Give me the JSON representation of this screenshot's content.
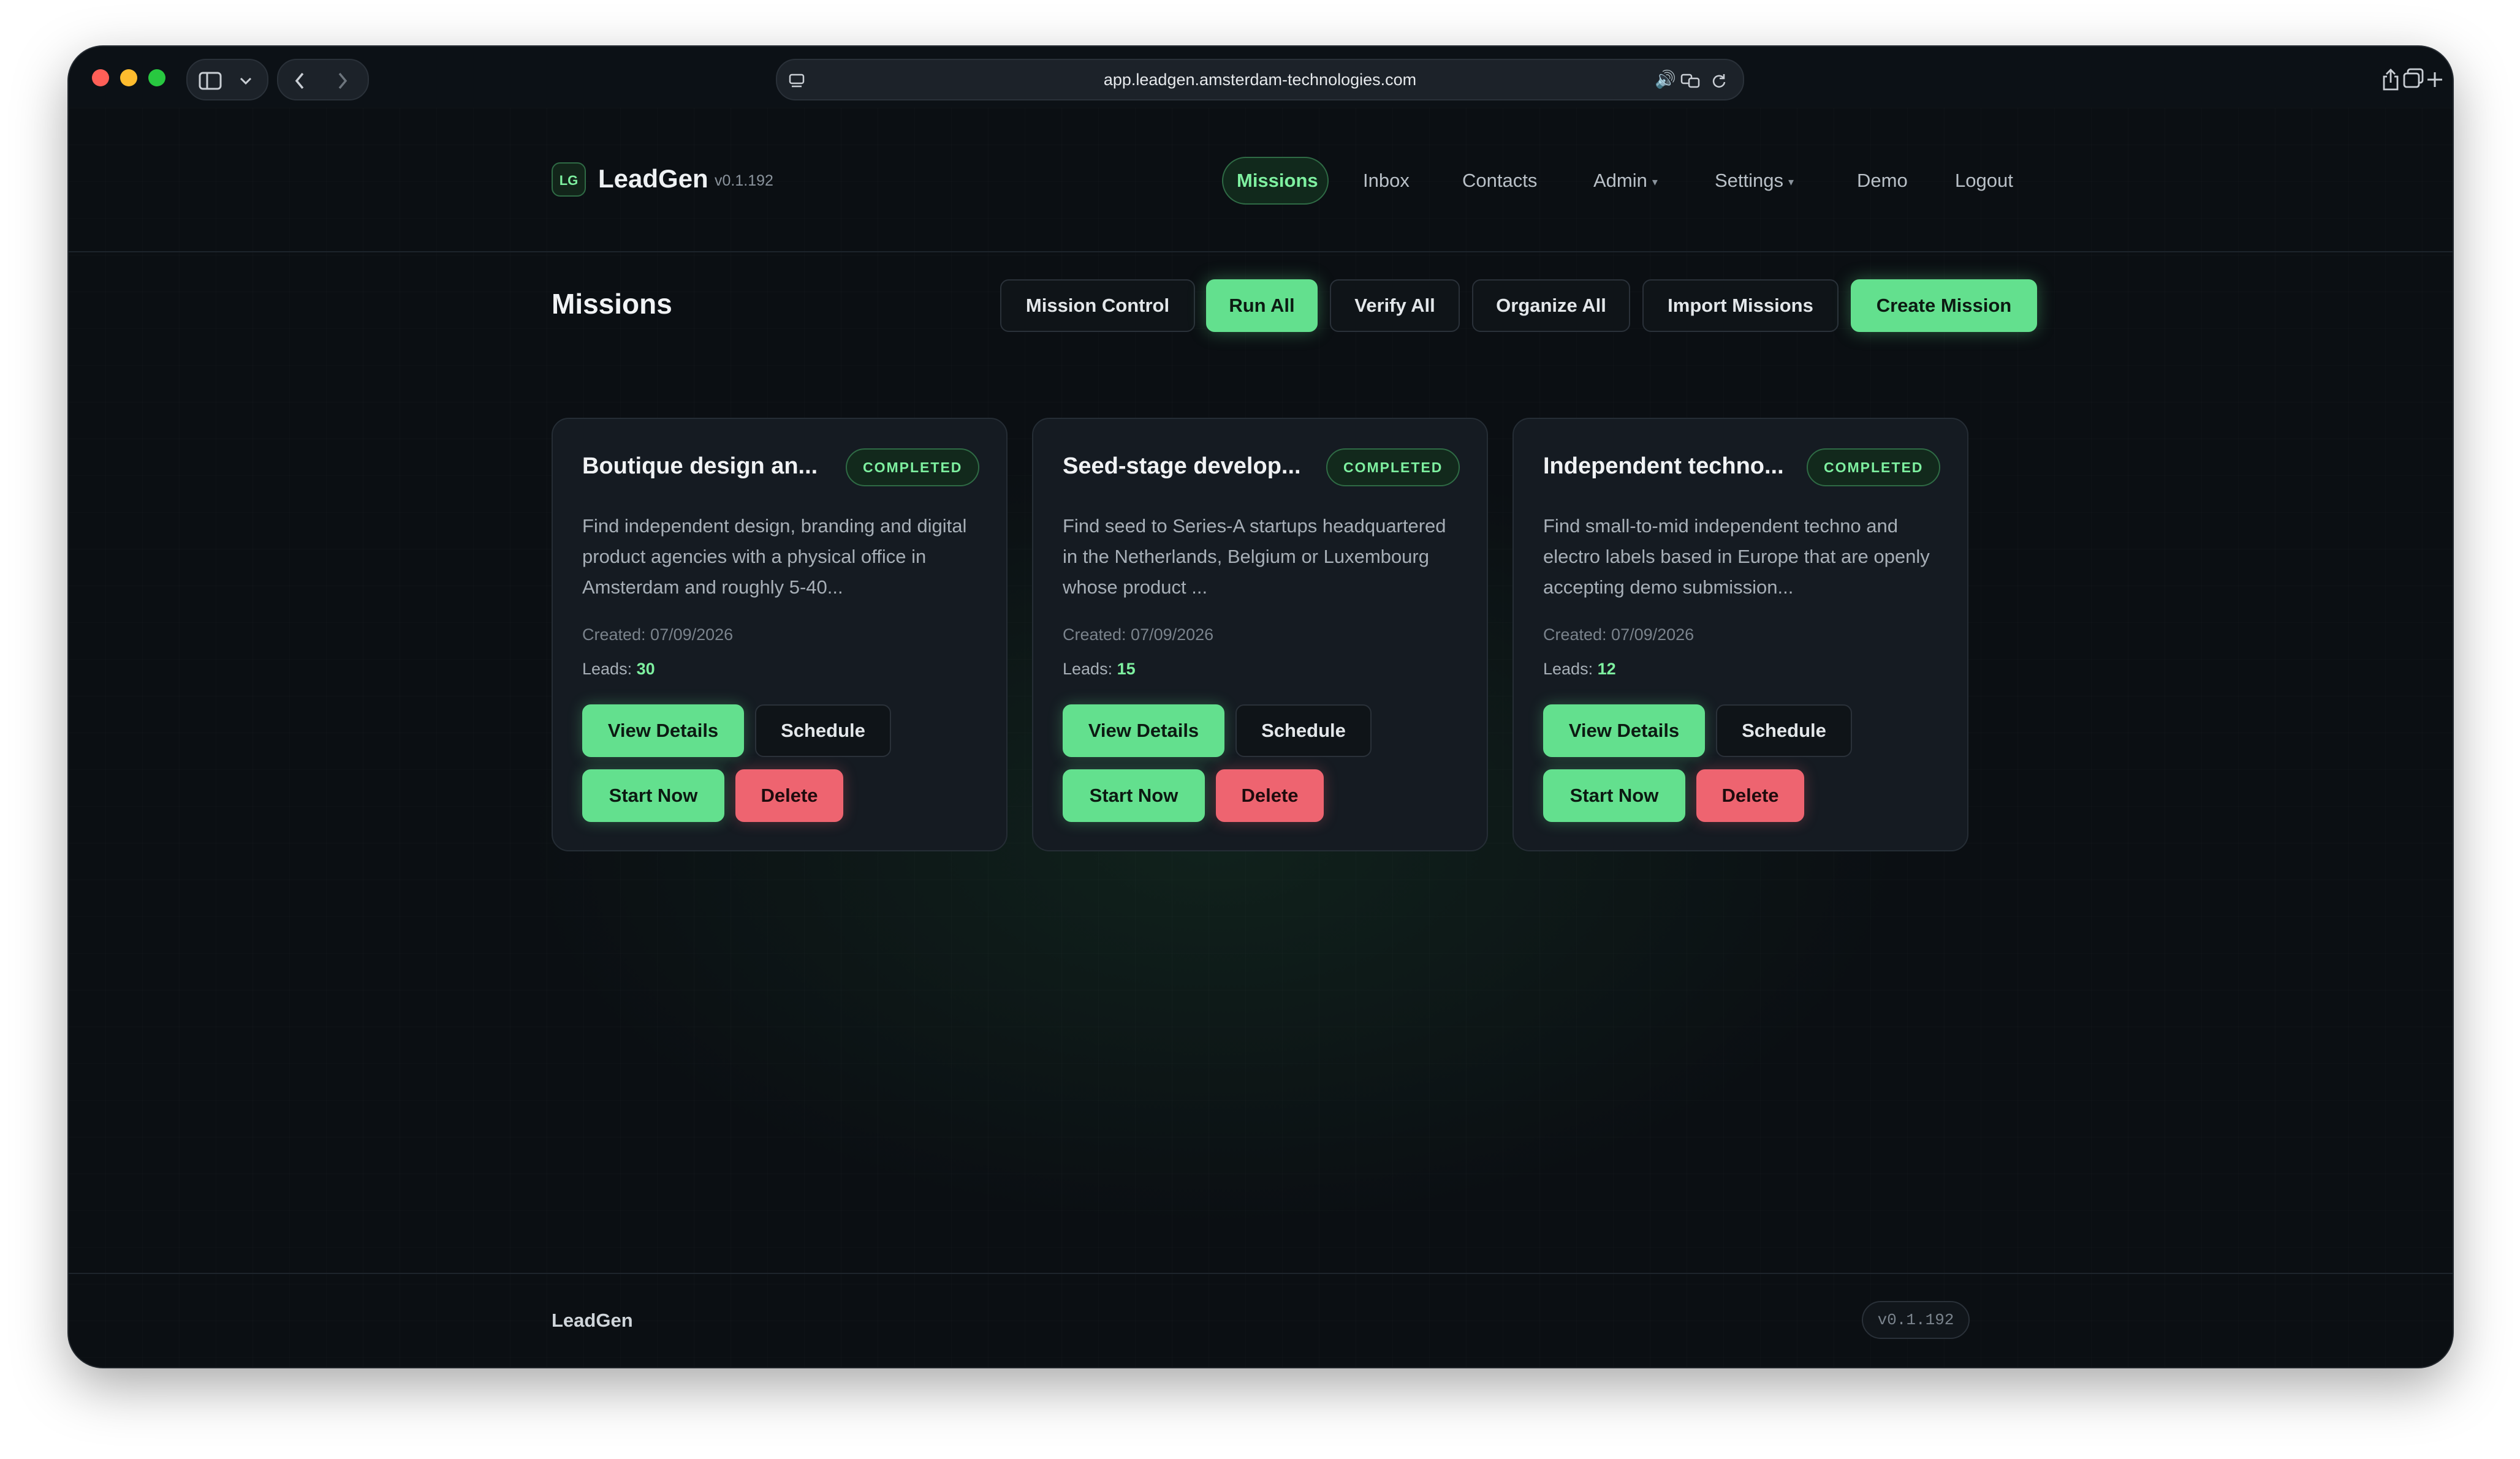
{
  "browser": {
    "url": "app.leadgen.amsterdam-technologies.com",
    "icons": {
      "sidebar": "sidebar-toggle-icon",
      "back": "chevron-left-icon",
      "forward": "chevron-right-icon",
      "share": "share-icon",
      "new_tab": "plus-icon",
      "tabs": "tabs-overview-icon"
    }
  },
  "header": {
    "logo_text": "LG",
    "brand": "LeadGen",
    "version": "v0.1.192",
    "nav": [
      {
        "label": "Missions",
        "active": true
      },
      {
        "label": "Inbox"
      },
      {
        "label": "Contacts"
      },
      {
        "label": "Admin",
        "has_dropdown": true
      },
      {
        "label": "Settings",
        "has_dropdown": true
      },
      {
        "label": "Demo"
      },
      {
        "label": "Logout"
      }
    ]
  },
  "page": {
    "title": "Missions",
    "toolbar": [
      {
        "label": "Mission Control"
      },
      {
        "label": "Run All"
      },
      {
        "label": "Verify All"
      },
      {
        "label": "Organize All"
      },
      {
        "label": "Import Missions"
      },
      {
        "label": "Create Mission"
      }
    ]
  },
  "missions": [
    {
      "title": "Boutique design an...",
      "status": "COMPLETED",
      "description": "Find independent design, branding and digital product agencies with a physical office in Amsterdam and roughly 5-40...",
      "created": "Created: 07/09/2026",
      "leads_label": "Leads:",
      "leads": "30",
      "buttons": {
        "view": "View Details",
        "schedule": "Schedule",
        "start": "Start Now",
        "delete": "Delete"
      }
    },
    {
      "title": "Seed-stage develop...",
      "status": "COMPLETED",
      "description": "Find seed to Series-A startups headquartered in the Netherlands, Belgium or Luxembourg whose product ...",
      "created": "Created: 07/09/2026",
      "leads_label": "Leads:",
      "leads": "15",
      "buttons": {
        "view": "View Details",
        "schedule": "Schedule",
        "start": "Start Now",
        "delete": "Delete"
      }
    },
    {
      "title": "Independent techno...",
      "status": "COMPLETED",
      "description": "Find small-to-mid independent techno and electro labels based in Europe that are openly accepting demo submission...",
      "created": "Created: 07/09/2026",
      "leads_label": "Leads:",
      "leads": "12",
      "buttons": {
        "view": "View Details",
        "schedule": "Schedule",
        "start": "Start Now",
        "delete": "Delete"
      }
    }
  ],
  "footer": {
    "brand": "LeadGen",
    "version": "v0.1.192"
  },
  "colors": {
    "accent": "#63e08e",
    "accent_text": "#7ef0a0",
    "danger": "#ee6470",
    "background": "#0b0f13",
    "card": "#151b22"
  }
}
